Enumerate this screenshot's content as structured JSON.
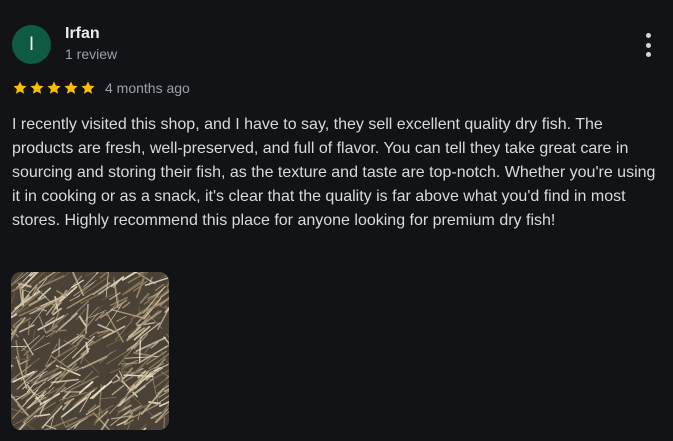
{
  "review": {
    "author": {
      "avatar_initial": "I",
      "avatar_color": "#0f5a45",
      "name": "Irfan",
      "subtitle": "1 review"
    },
    "rating": {
      "stars": 5,
      "max_stars": 5,
      "star_color": "#fbbc04",
      "time_ago": "4 months ago"
    },
    "text": "I recently visited this shop, and I have to say, they sell excellent quality dry fish. The products are fresh, well-preserved, and full of flavor. You can tell they take great care in sourcing and storing their fish, as the texture and taste are top-notch. Whether you're using it in cooking or as a snack, it's clear that the quality is far above what you'd find in most stores. Highly recommend this place for anyone looking for premium dry fish!",
    "more_options_icon": "more-vert-icon",
    "photo": {
      "subject": "dried fish"
    }
  },
  "theme": {
    "background": "#121317",
    "text_primary": "#ececec",
    "text_secondary": "#9aa0a6"
  }
}
